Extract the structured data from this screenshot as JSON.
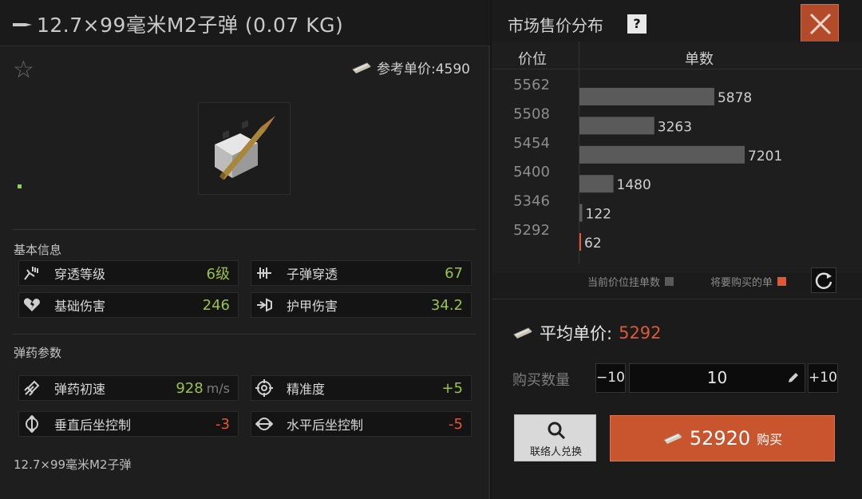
{
  "item": {
    "title": "12.7×99毫米M2子弹 (0.07 KG)",
    "ref_price_label": "参考单价:4590",
    "footer_name": "12.7×99毫米M2子弹"
  },
  "sections": {
    "basic": "基本信息",
    "ammo": "弹药参数"
  },
  "stats_basic": [
    {
      "label": "穿透等级",
      "value": "6级",
      "icon": "penetration-level-icon"
    },
    {
      "label": "子弹穿透",
      "value": "67",
      "icon": "bullet-penetration-icon"
    },
    {
      "label": "基础伤害",
      "value": "246",
      "icon": "base-damage-icon"
    },
    {
      "label": "护甲伤害",
      "value": "34.2",
      "icon": "armor-damage-icon"
    }
  ],
  "stats_ammo": [
    {
      "label": "弹药初速",
      "value": "928",
      "unit": "m/s",
      "icon": "muzzle-velocity-icon"
    },
    {
      "label": "精准度",
      "value": "+5",
      "icon": "accuracy-icon"
    },
    {
      "label": "垂直后坐控制",
      "value": "-3",
      "icon": "vertical-recoil-icon"
    },
    {
      "label": "水平后坐控制",
      "value": "-5",
      "icon": "horizontal-recoil-icon"
    }
  ],
  "market": {
    "title": "市场售价分布",
    "help": "?",
    "col_price": "价位",
    "col_count": "单数",
    "legend_current": "当前价位挂单数",
    "legend_buy": "将要购买的单",
    "avg_label": "平均单价:",
    "avg_value": "5292",
    "qty_label": "购买数量",
    "qty_minus": "−10",
    "qty_value": "10",
    "qty_plus": "+10",
    "contact_label": "联络人兑换",
    "buy_amount": "52920",
    "buy_label": "购买"
  },
  "colors": {
    "accent": "#c9552f",
    "green": "#9bc14a",
    "red": "#e0573a",
    "bar": "#5a5a5a",
    "buy_marker": "#e0573a"
  },
  "chart_data": {
    "type": "bar",
    "orientation": "horizontal",
    "categories": [
      "5562",
      "5508",
      "5454",
      "5400",
      "5346",
      "5292"
    ],
    "values": [
      5878,
      3263,
      7201,
      1480,
      122,
      62
    ],
    "xlabel": "单数",
    "ylabel": "价位",
    "xlim": [
      0,
      8000
    ],
    "highlight_category": "5292"
  }
}
